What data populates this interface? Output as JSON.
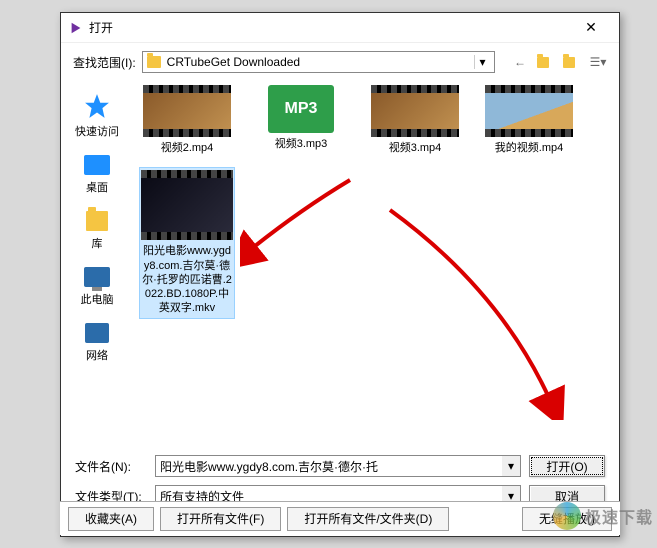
{
  "dialog": {
    "title": "打开",
    "look_in_label": "查找范围(I):",
    "look_in_value": "CRTubeGet Downloaded",
    "filename_label": "文件名(N):",
    "filename_value": "阳光电影www.ygdy8.com.吉尔莫·德尔·托",
    "filetype_label": "文件类型(T):",
    "filetype_value": "所有支持的文件",
    "open_btn": "打开(O)",
    "cancel_btn": "取消"
  },
  "sidebar": {
    "items": [
      {
        "label": "快速访问"
      },
      {
        "label": "桌面"
      },
      {
        "label": "库"
      },
      {
        "label": "此电脑"
      },
      {
        "label": "网络"
      }
    ]
  },
  "files": {
    "row1": [
      {
        "label": "视频2.mp4",
        "type": "video",
        "variant": "warm"
      },
      {
        "label": "视频3.mp3",
        "type": "mp3"
      },
      {
        "label": "视频3.mp4",
        "type": "video",
        "variant": "warm"
      },
      {
        "label": "我的视频.mp4",
        "type": "video",
        "variant": "sky"
      }
    ],
    "selected": {
      "label": "阳光电影www.ygdy8.com.吉尔莫·德尔·托罗的匹诺曹.2022.BD.1080P.中英双字.mkv",
      "type": "video",
      "variant": "dark"
    }
  },
  "mp3_text": "MP3",
  "bottom_buttons": {
    "favorites": "收藏夹(A)",
    "open_all_files": "打开所有文件(F)",
    "open_all_folders": "打开所有文件/文件夹(D)",
    "seamless": "无缝播放()"
  },
  "watermark": "极速下载",
  "colors": {
    "selection": "#cce8ff",
    "mp3": "#2e9e4a",
    "arrow": "#d90000"
  }
}
